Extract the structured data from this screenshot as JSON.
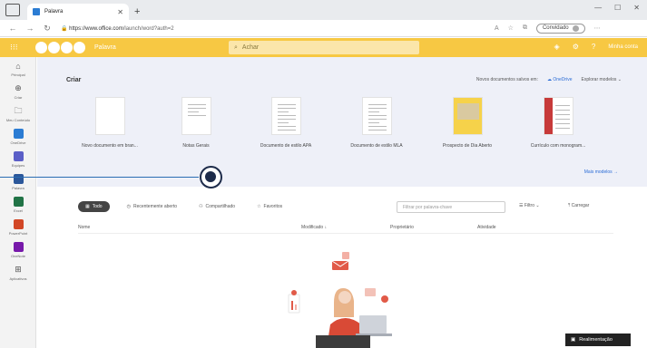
{
  "browser": {
    "tab_title": "Palavra",
    "url_host": "https://www.office.com",
    "url_path": "/launch/word?auth=2",
    "profile_label": "Convidado"
  },
  "header": {
    "app_name": "Palavra",
    "search_placeholder": "Achar",
    "account_label": "Minha conta",
    "accent_color": "#f7c843"
  },
  "rail": {
    "items": [
      {
        "label": "Principal",
        "icon": "home-icon",
        "color": ""
      },
      {
        "label": "Criar",
        "icon": "plus-icon",
        "color": ""
      },
      {
        "label": "Meu Conteúdo",
        "icon": "folder-icon",
        "color": ""
      },
      {
        "label": "OneDrive",
        "icon": "onedrive-icon",
        "color": "#2b7cd3"
      },
      {
        "label": "Equipes",
        "icon": "teams-icon",
        "color": "#5b5fc7"
      },
      {
        "label": "Palavra",
        "icon": "word-icon",
        "color": "#2b579a"
      },
      {
        "label": "Excel",
        "icon": "excel-icon",
        "color": "#217346"
      },
      {
        "label": "PowerPoint",
        "icon": "powerpoint-icon",
        "color": "#d24726"
      },
      {
        "label": "OneNote",
        "icon": "onenote-icon",
        "color": "#7719aa"
      },
      {
        "label": "Aplicativos",
        "icon": "apps-icon",
        "color": ""
      }
    ]
  },
  "create": {
    "title": "Criar",
    "save_to_label": "Novos documentos salvos em:",
    "onedrive_label": "OneDrive",
    "explore_label": "Explorar modelos",
    "more_templates": "Mais modelos →",
    "templates": [
      {
        "name": "Novo documento em bran...",
        "kind": "blank"
      },
      {
        "name": "Notas Gerais",
        "kind": "notes"
      },
      {
        "name": "Documento de estilo APA",
        "kind": "apa"
      },
      {
        "name": "Documento de estilo MLA",
        "kind": "mla"
      },
      {
        "name": "Prospecto de Dia Aberto",
        "kind": "flyer"
      },
      {
        "name": "Currículo com monogram...",
        "kind": "resume"
      }
    ]
  },
  "filters": {
    "chips": [
      {
        "label": "Todo",
        "icon": "grid-icon",
        "active": true
      },
      {
        "label": "Recentemente aberto",
        "icon": "clock-icon",
        "active": false
      },
      {
        "label": "Compartilhado",
        "icon": "people-icon",
        "active": false
      },
      {
        "label": "Favoritos",
        "icon": "star-icon",
        "active": false
      }
    ],
    "filter_placeholder": "Filtrar por palavra-chave",
    "filter_button": "Filtro",
    "upload_button": "Carregar"
  },
  "table": {
    "columns": [
      "Nome",
      "Modificado ↓",
      "Proprietário",
      "Atividade"
    ]
  },
  "feedback_label": "Realimentação"
}
